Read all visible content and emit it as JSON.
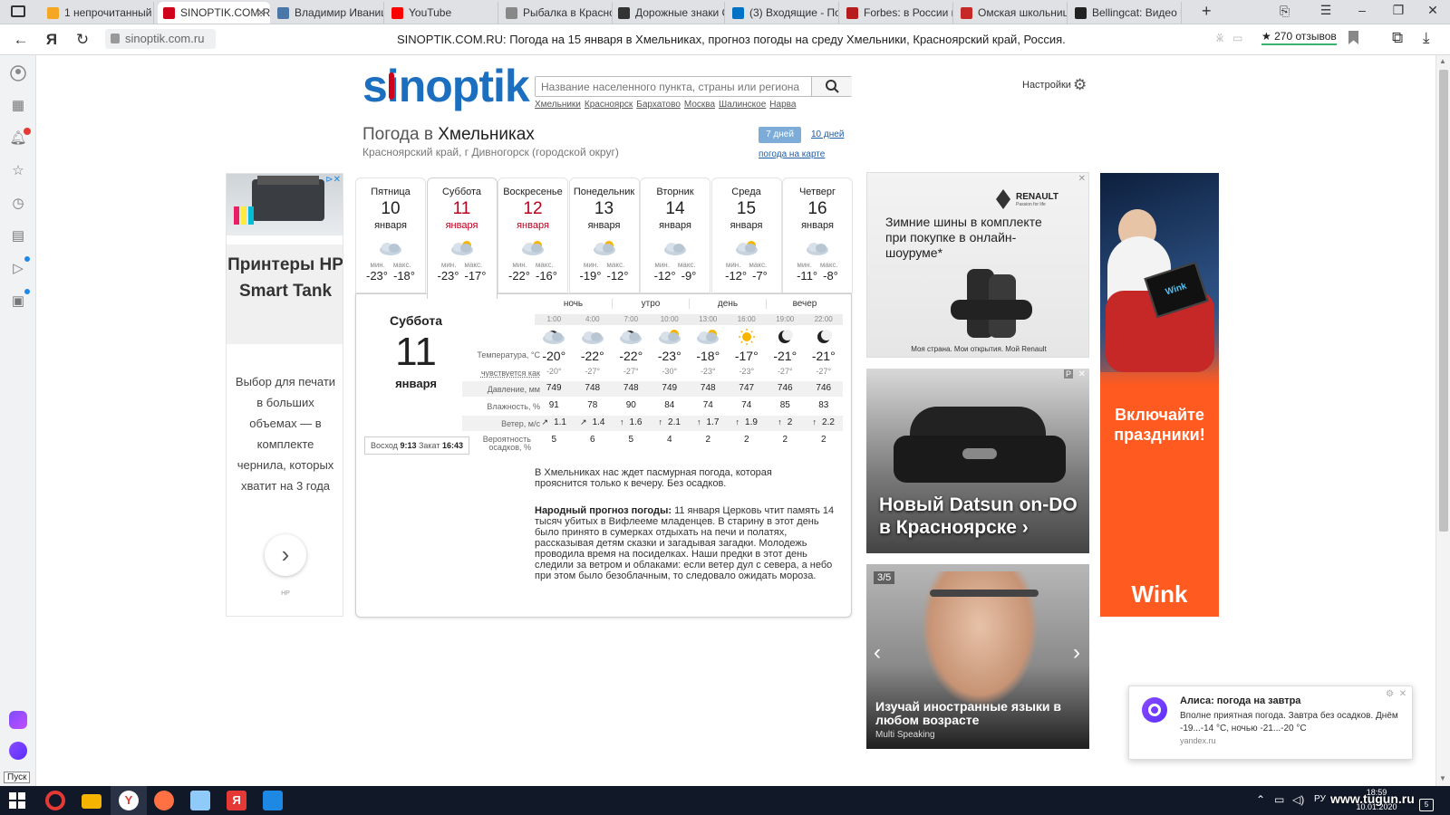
{
  "tabs": [
    {
      "label": "1 непрочитанный",
      "icon": "mail-icon",
      "color": "#f5a623"
    },
    {
      "label": "SINOPTIK.COM.R",
      "icon": "thermometer-icon",
      "color": "#d0021b"
    },
    {
      "label": "Владимир Иваниц",
      "icon": "vk-icon",
      "color": "#4a76a8"
    },
    {
      "label": "YouTube",
      "icon": "youtube-icon",
      "color": "#ff0000"
    },
    {
      "label": "Рыбалка в Красно",
      "icon": "fish-icon",
      "color": "#888888"
    },
    {
      "label": "Дорожные знаки С",
      "icon": "wiki-icon",
      "color": "#333333"
    },
    {
      "label": "(3) Входящие - Поч",
      "icon": "outlook-icon",
      "color": "#0072c6"
    },
    {
      "label": "Forbes: в России п",
      "icon": "forbes-icon",
      "color": "#b71c1c"
    },
    {
      "label": "Омская школьниц",
      "icon": "news-icon",
      "color": "#c62828"
    },
    {
      "label": "Bellingcat: Видео п",
      "icon": "bellingcat-icon",
      "color": "#222222"
    }
  ],
  "address": {
    "url": "sinoptik.com.ru",
    "page_title": "SINOPTIK.COM.RU: Погода на 15 января в Хмельниках, прогноз погоды на среду Хмельники, Красноярский край, Россия.",
    "reviews": "★ 270 отзывов",
    "yandex_letter": "Я"
  },
  "site": {
    "logo": "sinoptik",
    "search_placeholder": "Название населенного пункта, страны или региона",
    "settings_label": "Настройки",
    "quick_links": [
      "Хмельники",
      "Красноярск",
      "Бархатово",
      "Москва",
      "Шалинское",
      "Нарва"
    ],
    "title_prefix": "Погода в",
    "title_city": "Хмельниках",
    "subtitle": "Красноярский край, г Дивногорск (городской округ)",
    "tab_7days": "7 дней",
    "tab_10days": "10 дней",
    "map_link": "погода на карте"
  },
  "days": [
    {
      "name": "Пятница",
      "num": "10",
      "month": "января",
      "min_label": "мин.",
      "max_label": "макс.",
      "min": "-23°",
      "max": "-18°",
      "red": false
    },
    {
      "name": "Суббота",
      "num": "11",
      "month": "января",
      "min_label": "мин.",
      "max_label": "макс.",
      "min": "-23°",
      "max": "-17°",
      "red": true
    },
    {
      "name": "Воскресенье",
      "num": "12",
      "month": "января",
      "min_label": "мин.",
      "max_label": "макс.",
      "min": "-22°",
      "max": "-16°",
      "red": true
    },
    {
      "name": "Понедельник",
      "num": "13",
      "month": "января",
      "min_label": "мин.",
      "max_label": "макс.",
      "min": "-19°",
      "max": "-12°",
      "red": false
    },
    {
      "name": "Вторник",
      "num": "14",
      "month": "января",
      "min_label": "мин.",
      "max_label": "макс.",
      "min": "-12°",
      "max": "-9°",
      "red": false
    },
    {
      "name": "Среда",
      "num": "15",
      "month": "января",
      "min_label": "мин.",
      "max_label": "макс.",
      "min": "-12°",
      "max": "-7°",
      "red": false
    },
    {
      "name": "Четверг",
      "num": "16",
      "month": "января",
      "min_label": "мин.",
      "max_label": "макс.",
      "min": "-11°",
      "max": "-8°",
      "red": false
    }
  ],
  "detail": {
    "day_name": "Суббота",
    "day_num": "11",
    "month": "января",
    "sunrise_label": "Восход",
    "sunrise": "9:13",
    "sunset_label": "Закат",
    "sunset": "16:43",
    "periods": [
      "ночь",
      "утро",
      "день",
      "вечер"
    ],
    "hours": [
      "1:00",
      "4:00",
      "7:00",
      "10:00",
      "13:00",
      "16:00",
      "19:00",
      "22:00"
    ],
    "row_labels": {
      "temp": "Температура, °C",
      "feels": "чувствуется как",
      "pressure": "Давление, мм",
      "humidity": "Влажность, %",
      "wind": "Ветер, м/с",
      "precip": "Вероятность осадков, %"
    },
    "temp": [
      "-20°",
      "-22°",
      "-22°",
      "-23°",
      "-18°",
      "-17°",
      "-21°",
      "-21°"
    ],
    "feels": [
      "-20°",
      "-27°",
      "-27°",
      "-30°",
      "-23°",
      "-23°",
      "-27°",
      "-27°"
    ],
    "pressure": [
      "749",
      "748",
      "748",
      "749",
      "748",
      "747",
      "746",
      "746"
    ],
    "humidity": [
      "91",
      "78",
      "90",
      "84",
      "74",
      "74",
      "85",
      "83"
    ],
    "wind": [
      "1.1",
      "1.4",
      "1.6",
      "2.1",
      "1.7",
      "1.9",
      "2",
      "2.2"
    ],
    "precip": [
      "5",
      "6",
      "5",
      "4",
      "2",
      "2",
      "2",
      "2"
    ],
    "description": "В Хмельниках нас ждет пасмурная погода, которая прояснится только к вечеру. Без осадков.",
    "folk_label": "Народный прогноз погоды:",
    "folk_text": "11 января Церковь чтит память 14 тысяч убитых в Вифлееме младенцев. В старину в этот день было принято в сумерках отдыхать на печи и полатях, рассказывая детям сказки и загадывая загадки. Молодежь проводила время на посиделках. Наши предки в этот день следили за ветром и облаками: если ветер дул с севера, а небо при этом было безоблачным, то следовало ожидать мороза."
  },
  "ads": {
    "hp_title": "Принтеры HP Smart Tank",
    "hp_text": "Выбор для печати в больших объемах — в комплекте чернила, которых хватит на 3 года",
    "hp_brand": "HP",
    "renault_brand": "RENAULT",
    "renault_tagline": "Passion for life",
    "renault_text": "Зимние шины в комплекте при покупке в онлайн-шоуруме*",
    "renault_footer": "Моя страна. Мои открытия. Мой Renault",
    "datsun_text": "Новый Datsun on-DO в Красноярске ›",
    "lang_counter": "3/5",
    "lang_text": "Изучай иностранные языки в любом возрасте",
    "lang_source": "Multi Speaking",
    "wink_text": "Включайте праздники!",
    "wink_brand": "Wink",
    "wink_tablet": "Wink"
  },
  "alice": {
    "title": "Алиса: погода на завтра",
    "body": "Вполне приятная погода. Завтра без осадков. Днём -19...-14 °С, ночью -21...-20 °С",
    "source": "yandex.ru"
  },
  "taskbar": {
    "start_label": "Пуск",
    "lang": "РУ",
    "time": "18:59",
    "date": "10.01.2020",
    "watermark": "www.tugun.ru",
    "notif_count": "5"
  }
}
